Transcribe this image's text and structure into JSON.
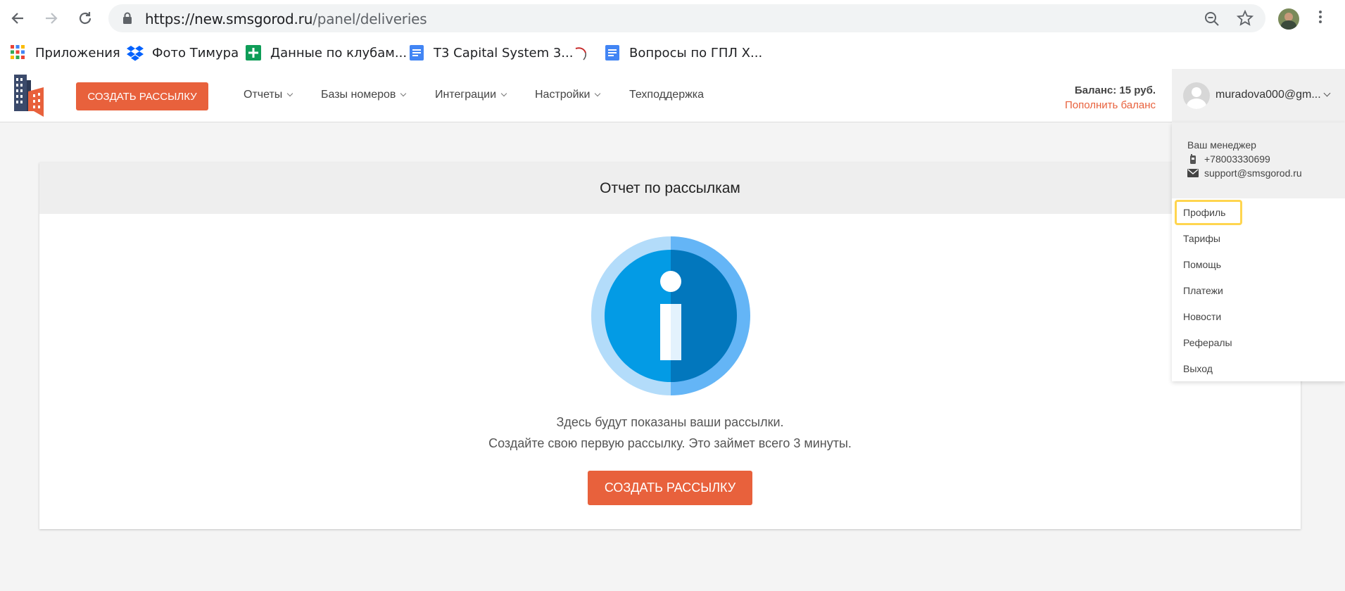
{
  "browser": {
    "url_host": "https://new.smsgorod.ru",
    "url_path": "/panel/deliveries",
    "bookmarks": [
      {
        "label": "Приложения",
        "icon": "apps-grid-icon"
      },
      {
        "label": "Фото Тимура",
        "icon": "dropbox-icon"
      },
      {
        "label": "Данные по клубам...",
        "icon": "google-sheets-icon"
      },
      {
        "label": "T3 Capital System 3...",
        "icon": "google-docs-icon"
      },
      {
        "label": "",
        "icon": "feather-icon"
      },
      {
        "label": "Вопросы по ГПЛ Х...",
        "icon": "google-docs-icon"
      }
    ]
  },
  "header": {
    "create_label": "СОЗДАТЬ РАССЫЛКУ",
    "menu": [
      {
        "label": "Отчеты"
      },
      {
        "label": "Базы номеров"
      },
      {
        "label": "Интеграции"
      },
      {
        "label": "Настройки"
      },
      {
        "label": "Техподдержка"
      }
    ],
    "balance_label": "Баланс: 15 руб.",
    "topup_label": "Пополнить баланс",
    "user_email": "muradova000@gm..."
  },
  "dropdown": {
    "manager_title": "Ваш менеджер",
    "manager_phone": "+78003330699",
    "manager_email": "support@smsgorod.ru",
    "items": [
      {
        "label": "Профиль"
      },
      {
        "label": "Тарифы"
      },
      {
        "label": "Помощь"
      },
      {
        "label": "Платежи"
      },
      {
        "label": "Новости"
      },
      {
        "label": "Рефералы"
      },
      {
        "label": "Выход"
      }
    ]
  },
  "main": {
    "title": "Отчет по рассылкам",
    "line1": "Здесь будут показаны ваши рассылки.",
    "line2": "Создайте свою первую рассылку. Это займет всего 3 минуты.",
    "create_label": "СОЗДАТЬ РАССЫЛКУ"
  },
  "colors": {
    "accent": "#e8613c",
    "info_blue": "#0288d1",
    "highlight": "#ffd54f"
  }
}
